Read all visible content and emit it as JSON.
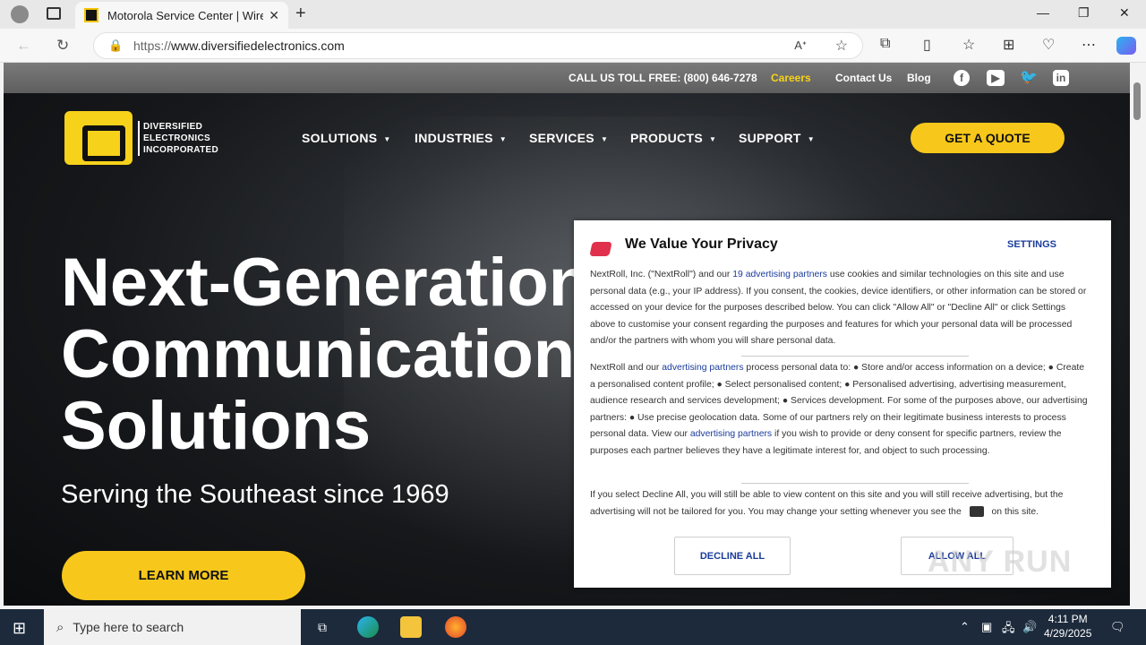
{
  "browser": {
    "tab_title": "Motorola Service Center | Wireless",
    "url_proto": "https://",
    "url_host": "www.diversifiedelectronics.com"
  },
  "topbar": {
    "phone": "CALL US TOLL FREE: (800) 646-7278",
    "careers": "Careers",
    "contact": "Contact Us",
    "blog": "Blog",
    "socials": [
      "facebook-icon",
      "youtube-icon",
      "twitter-icon",
      "linkedin-icon"
    ]
  },
  "logo": {
    "line1": "DIVERSIFIED",
    "line2": "ELECTRONICS",
    "line3": "INCORPORATED"
  },
  "nav": {
    "solutions": "SOLUTIONS",
    "industries": "INDUSTRIES",
    "services": "SERVICES",
    "products": "PRODUCTS",
    "support": "SUPPORT",
    "quote": "GET A QUOTE"
  },
  "hero": {
    "line1": "Next-Generation",
    "line2": "Communications",
    "line3": "Solutions",
    "subline": "Serving the Southeast since 1969",
    "cta": "LEARN MORE"
  },
  "consent": {
    "title": "We Value Your Privacy",
    "settings": "SETTINGS",
    "p1_a": "NextRoll, Inc. (\"NextRoll\") and our ",
    "p1_link": "19 advertising partners",
    "p1_b": " use cookies and similar technologies on this site and use personal data (e.g., your IP address). If you consent, the cookies, device identifiers, or other information can be stored or accessed on your device for the purposes described below. You can click \"Allow All\" or \"Decline All\" or click Settings above to customise your consent regarding the purposes and features for which your personal data will be processed and/or the partners with whom you will share personal data.",
    "p2_a": "NextRoll and our ",
    "p2_link1": "advertising partners",
    "p2_b": " process personal data to: ● Store and/or access information on a device; ● Create a personalised content profile; ● Select personalised content; ● Personalised advertising, advertising measurement, audience research and services development; ● Services development. For some of the purposes above, our advertising partners: ● Use precise geolocation data. Some of our partners rely on their legitimate business interests to process personal data. View our ",
    "p2_link2": "advertising partners",
    "p2_c": " if you wish to provide or deny consent for specific partners, review the purposes each partner believes they have a legitimate interest for, and object to such processing.",
    "p3": "If you select Decline All, you will still be able to view content on this site and you will still receive advertising, but the advertising will not be tailored for you. You may change your setting whenever you see the",
    "p3_end": "on this site.",
    "decline": "DECLINE ALL",
    "allow": "ALLOW ALL"
  },
  "watermark": "ANY RUN",
  "taskbar": {
    "search_placeholder": "Type here to search",
    "time": "4:11 PM",
    "date": "4/29/2025"
  }
}
